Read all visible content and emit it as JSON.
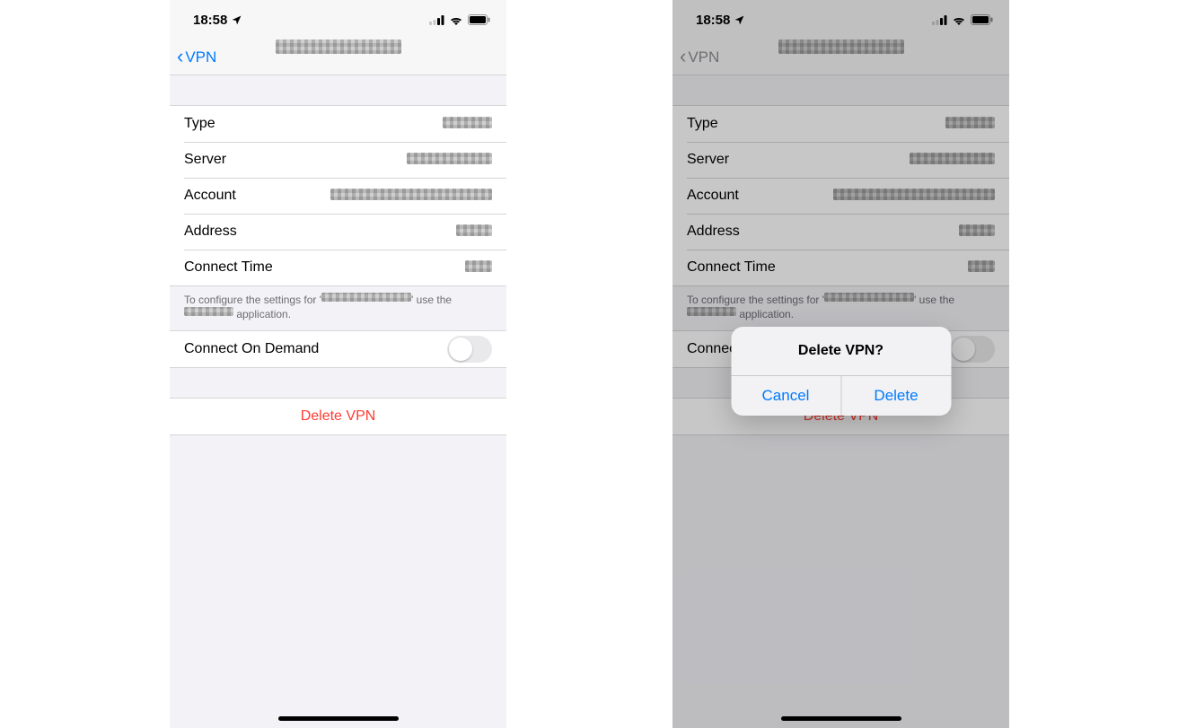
{
  "status": {
    "time": "18:58",
    "location_icon": "location-arrow-icon",
    "cellular_icon": "cellular-icon",
    "wifi_icon": "wifi-icon",
    "battery_icon": "battery-icon"
  },
  "nav": {
    "back_label": "VPN",
    "title": "██████ ██████"
  },
  "rows": {
    "type": {
      "label": "Type",
      "value": "██████"
    },
    "server": {
      "label": "Server",
      "value": "██████████"
    },
    "account": {
      "label": "Account",
      "value": "████████████████"
    },
    "address": {
      "label": "Address",
      "value": "█████"
    },
    "connect_time": {
      "label": "Connect Time",
      "value": "████"
    }
  },
  "footer_note_prefix": "To configure the settings for '",
  "footer_note_middle": "████████████",
  "footer_note_suffix_1": "' use the ",
  "footer_note_app": "███████",
  "footer_note_suffix_2": " application.",
  "connect_on_demand_label": "Connect On Demand",
  "delete_label": "Delete VPN",
  "alert": {
    "title": "Delete VPN?",
    "cancel": "Cancel",
    "delete": "Delete"
  }
}
